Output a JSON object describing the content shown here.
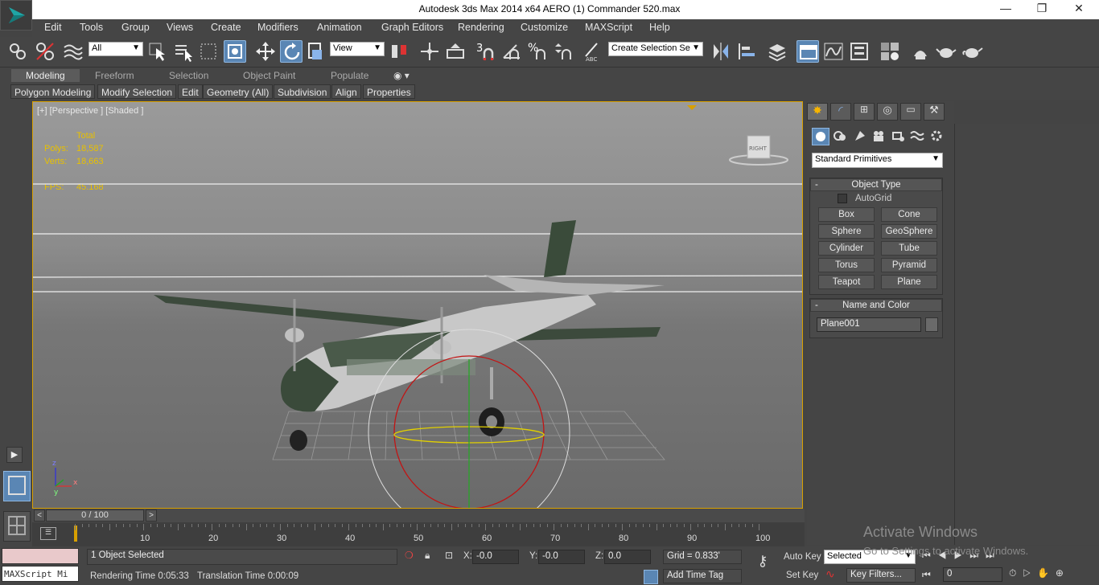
{
  "window": {
    "title": "Autodesk 3ds Max  2014 x64    AERO (1) Commander 520.max",
    "minimize": "—",
    "restore": "❐",
    "close": "✕"
  },
  "menu": [
    "Edit",
    "Tools",
    "Group",
    "Views",
    "Create",
    "Modifiers",
    "Animation",
    "Graph Editors",
    "Rendering",
    "Customize",
    "MAXScript",
    "Help"
  ],
  "toolbar": {
    "filter_value": "All",
    "refcoord_value": "View",
    "selset_placeholder": "Create Selection Se"
  },
  "ribbon": {
    "tabs": [
      "Modeling",
      "Freeform",
      "Selection",
      "Object Paint",
      "Populate"
    ],
    "panels": [
      "Polygon Modeling",
      "Modify Selection",
      "Edit",
      "Geometry (All)",
      "Subdivision",
      "Align",
      "Properties"
    ]
  },
  "viewport": {
    "label": "[+] [Perspective ] [Shaded ]",
    "viewcube_label": "RIGHT",
    "stats": {
      "total": "Total",
      "polys_label": "Polys:",
      "polys": "18,587",
      "verts_label": "Verts:",
      "verts": "18,663",
      "fps_label": "FPS:",
      "fps": "45.168"
    },
    "axis": {
      "z": "z",
      "x": "x",
      "y": "y"
    }
  },
  "command_panel": {
    "category": "Standard Primitives",
    "object_type_title": "Object Type",
    "autogrid": "AutoGrid",
    "buttons": [
      "Box",
      "Cone",
      "Sphere",
      "GeoSphere",
      "Cylinder",
      "Tube",
      "Torus",
      "Pyramid",
      "Teapot",
      "Plane"
    ],
    "name_color_title": "Name and Color",
    "name_value": "Plane001",
    "minus": "-"
  },
  "timeline": {
    "frame": "0 / 100",
    "ticks": [
      "10",
      "20",
      "30",
      "40",
      "50",
      "60",
      "70",
      "80",
      "90",
      "100"
    ],
    "prev": "<",
    "next": ">"
  },
  "status": {
    "selected": "1 Object Selected",
    "render_time": "Rendering Time  0:05:33",
    "translation_time": "Translation Time  0:00:09",
    "x_label": "X:",
    "x": "-0.0",
    "y_label": "Y:",
    "y": "-0.0",
    "z_label": "Z:",
    "z": "0.0",
    "grid": "Grid = 0.833'",
    "add_time_tag": "Add Time Tag",
    "auto_key": "Auto Key",
    "set_key": "Set Key",
    "selected_dd": "Selected",
    "key_filters": "Key Filters...",
    "frame_value": "0",
    "maxscript": "MAXScript Mi"
  },
  "watermark": {
    "line1": "Activate Windows",
    "line2": "Go to Settings to activate Windows."
  }
}
